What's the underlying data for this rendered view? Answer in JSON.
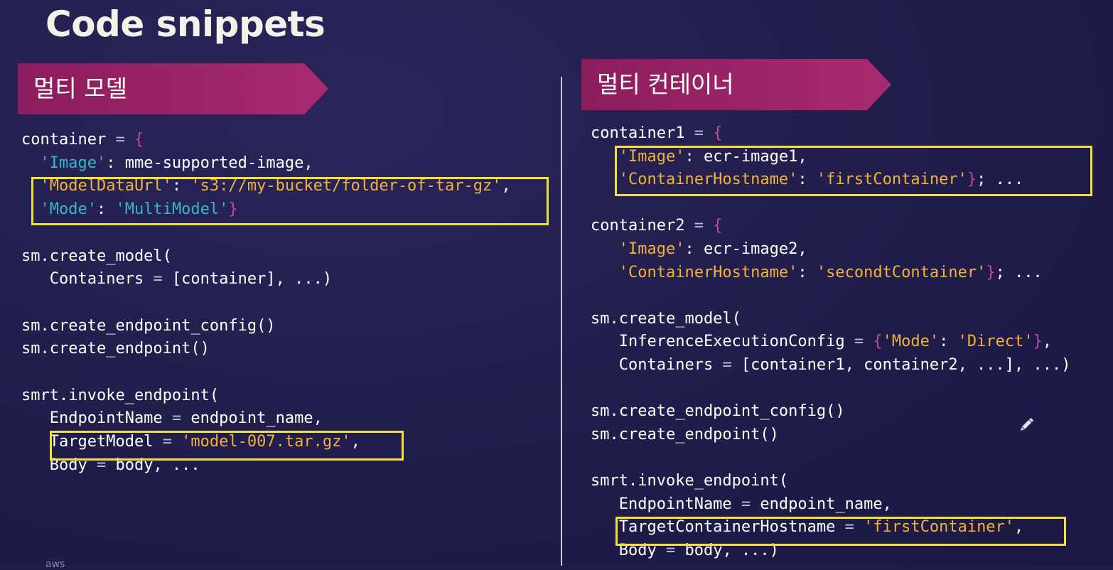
{
  "slide": {
    "title": "Code snippets",
    "left_banner": "멀티 모델",
    "right_banner": "멀티 컨테이너",
    "footer_logo_text": "aws"
  },
  "colors": {
    "background": "#211d4a",
    "banner": "#9b2468",
    "highlight_box": "#f0e23a",
    "string": "#f2b23a",
    "dict_key": "#37b7c6",
    "brace": "#c24d94"
  },
  "left_code": [
    [
      {
        "t": "container ",
        "c": "plain"
      },
      {
        "t": "=",
        "c": "op"
      },
      {
        "t": " ",
        "c": "plain"
      },
      {
        "t": "{",
        "c": "brace"
      }
    ],
    [
      {
        "t": "  'Image'",
        "c": "key"
      },
      {
        "t": ": mme-supported-image,",
        "c": "plain"
      }
    ],
    [
      {
        "t": "  'ModelDataUrl'",
        "c": "str"
      },
      {
        "t": ": ",
        "c": "plain"
      },
      {
        "t": "'s3://my-bucket/folder-of-tar-gz'",
        "c": "str"
      },
      {
        "t": ",",
        "c": "plain"
      }
    ],
    [
      {
        "t": "  'Mode'",
        "c": "key"
      },
      {
        "t": ": ",
        "c": "plain"
      },
      {
        "t": "'MultiModel'",
        "c": "key"
      },
      {
        "t": "}",
        "c": "brace"
      }
    ],
    [],
    [
      {
        "t": "sm.create_model(",
        "c": "plain"
      }
    ],
    [
      {
        "t": "   Containers ",
        "c": "plain"
      },
      {
        "t": "=",
        "c": "op"
      },
      {
        "t": " [container], ...)",
        "c": "plain"
      }
    ],
    [],
    [
      {
        "t": "sm.create_endpoint_config()",
        "c": "plain"
      }
    ],
    [
      {
        "t": "sm.create_endpoint()",
        "c": "plain"
      }
    ],
    [],
    [
      {
        "t": "smrt.invoke_endpoint(",
        "c": "plain"
      }
    ],
    [
      {
        "t": "   EndpointName ",
        "c": "plain"
      },
      {
        "t": "=",
        "c": "op"
      },
      {
        "t": " endpoint_name,",
        "c": "plain"
      }
    ],
    [
      {
        "t": "   TargetModel ",
        "c": "plain"
      },
      {
        "t": "=",
        "c": "op"
      },
      {
        "t": " ",
        "c": "plain"
      },
      {
        "t": "'model-007.tar.gz'",
        "c": "str"
      },
      {
        "t": ",",
        "c": "plain"
      }
    ],
    [
      {
        "t": "   Body ",
        "c": "plain"
      },
      {
        "t": "=",
        "c": "op"
      },
      {
        "t": " body, ...",
        "c": "plain"
      }
    ]
  ],
  "right_code": [
    [
      {
        "t": "container1 ",
        "c": "plain"
      },
      {
        "t": "=",
        "c": "op"
      },
      {
        "t": " ",
        "c": "plain"
      },
      {
        "t": "{",
        "c": "brace"
      }
    ],
    [
      {
        "t": "   'Image'",
        "c": "str"
      },
      {
        "t": ": ecr-image1,",
        "c": "plain"
      }
    ],
    [
      {
        "t": "   'ContainerHostname'",
        "c": "str"
      },
      {
        "t": ": ",
        "c": "plain"
      },
      {
        "t": "'firstContainer'",
        "c": "str"
      },
      {
        "t": "}",
        "c": "brace"
      },
      {
        "t": "; ...",
        "c": "plain"
      }
    ],
    [],
    [
      {
        "t": "container2 ",
        "c": "plain"
      },
      {
        "t": "=",
        "c": "op"
      },
      {
        "t": " ",
        "c": "plain"
      },
      {
        "t": "{",
        "c": "brace"
      }
    ],
    [
      {
        "t": "   'Image'",
        "c": "str"
      },
      {
        "t": ": ecr-image2,",
        "c": "plain"
      }
    ],
    [
      {
        "t": "   'ContainerHostname'",
        "c": "str"
      },
      {
        "t": ": ",
        "c": "plain"
      },
      {
        "t": "'secondtContainer'",
        "c": "str"
      },
      {
        "t": "}",
        "c": "brace"
      },
      {
        "t": "; ...",
        "c": "plain"
      }
    ],
    [],
    [
      {
        "t": "sm.create_model(",
        "c": "plain"
      }
    ],
    [
      {
        "t": "   InferenceExecutionConfig ",
        "c": "plain"
      },
      {
        "t": "=",
        "c": "op"
      },
      {
        "t": " ",
        "c": "plain"
      },
      {
        "t": "{",
        "c": "brace"
      },
      {
        "t": "'Mode'",
        "c": "str"
      },
      {
        "t": ": ",
        "c": "plain"
      },
      {
        "t": "'Direct'",
        "c": "str"
      },
      {
        "t": "}",
        "c": "brace"
      },
      {
        "t": ",",
        "c": "plain"
      }
    ],
    [
      {
        "t": "   Containers ",
        "c": "plain"
      },
      {
        "t": "=",
        "c": "op"
      },
      {
        "t": " [container1, container2, ...], ...)",
        "c": "plain"
      }
    ],
    [],
    [
      {
        "t": "sm.create_endpoint_config()",
        "c": "plain"
      }
    ],
    [
      {
        "t": "sm.create_endpoint()",
        "c": "plain"
      }
    ],
    [],
    [
      {
        "t": "smrt.invoke_endpoint(",
        "c": "plain"
      }
    ],
    [
      {
        "t": "   EndpointName ",
        "c": "plain"
      },
      {
        "t": "=",
        "c": "op"
      },
      {
        "t": " endpoint_name,",
        "c": "plain"
      }
    ],
    [
      {
        "t": "   TargetContainerHostname ",
        "c": "plain"
      },
      {
        "t": "=",
        "c": "op"
      },
      {
        "t": " ",
        "c": "plain"
      },
      {
        "t": "'firstContainer'",
        "c": "str"
      },
      {
        "t": ",",
        "c": "plain"
      }
    ],
    [
      {
        "t": "   Body ",
        "c": "plain"
      },
      {
        "t": "=",
        "c": "op"
      },
      {
        "t": " body, ...)",
        "c": "plain"
      }
    ]
  ]
}
